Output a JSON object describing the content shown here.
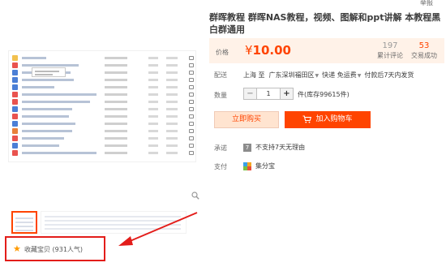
{
  "header": {
    "report_label": "举报"
  },
  "product": {
    "title": "群晖教程 群晖NAS教程，视频、图解和ppt讲解 本教程黑白群通用"
  },
  "price": {
    "label": "价格",
    "currency": "¥",
    "value": "10.00",
    "reviews_count": "197",
    "reviews_label": "累计评论",
    "trades_count": "53",
    "trades_label": "交易成功"
  },
  "shipping": {
    "label": "配送",
    "origin": "上海 至",
    "destination": "广东深圳福田区",
    "method": "快递 免运费",
    "dispatch": "付款后7天内发货"
  },
  "quantity": {
    "label": "数量",
    "minus": "−",
    "value": "1",
    "plus": "+",
    "stock": "件(库存99615件)"
  },
  "actions": {
    "buy_now": "立即购买",
    "add_to_cart": "加入购物车"
  },
  "promise": {
    "label": "承诺",
    "badge": "7",
    "text": "不支持7天无理由"
  },
  "payment": {
    "label": "支付",
    "method": "集分宝"
  },
  "favorite": {
    "label": "收藏宝贝 (931人气)"
  },
  "colors": {
    "accent": "#ff4400",
    "price_bg": "#fff2e8",
    "highlight_red": "#e31d1a",
    "star": "#ff9a00"
  },
  "icons": [
    "zoom-icon",
    "star-icon",
    "cart-icon",
    "caret-down-icon",
    "payment-icon"
  ]
}
